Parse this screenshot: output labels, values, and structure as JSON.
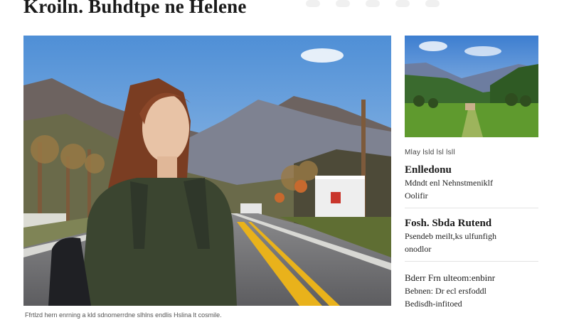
{
  "article": {
    "headline": "Kroiln. Buhdtpe ne Helene",
    "hero_caption": "Ffrtlzd hern enrning a kld sdnomerrdne slhlns endlis Hslina lt cosmile.",
    "hero_image": "young woman standing on a rural mountain road in autumn"
  },
  "sidebar": {
    "thumb_image": "green valley farmland with mountains",
    "kicker": "Mlay lsld lsl lsll",
    "stories": [
      {
        "title": "Enlledonu",
        "lines": [
          "Mdndt enl Nehnstmeniklf",
          "Oolifir"
        ]
      },
      {
        "title": "Fosh. Sbda Rutend",
        "lines": [
          "Psendeb meilt,ks ulfunfigh",
          "onodlor"
        ]
      },
      {
        "title": "Bderr Frn ulteom:enbinr",
        "lines": [
          "Bebnen: Dr ecl ersfoddl",
          "Bedisdh-infitoed"
        ]
      }
    ]
  },
  "colors": {
    "sky": "#7fb0e2",
    "road": "#6f6f72",
    "center_line": "#e9b21b",
    "jacket": "#3b4530",
    "hair": "#7a3d22",
    "field": "#5f9a2e"
  }
}
